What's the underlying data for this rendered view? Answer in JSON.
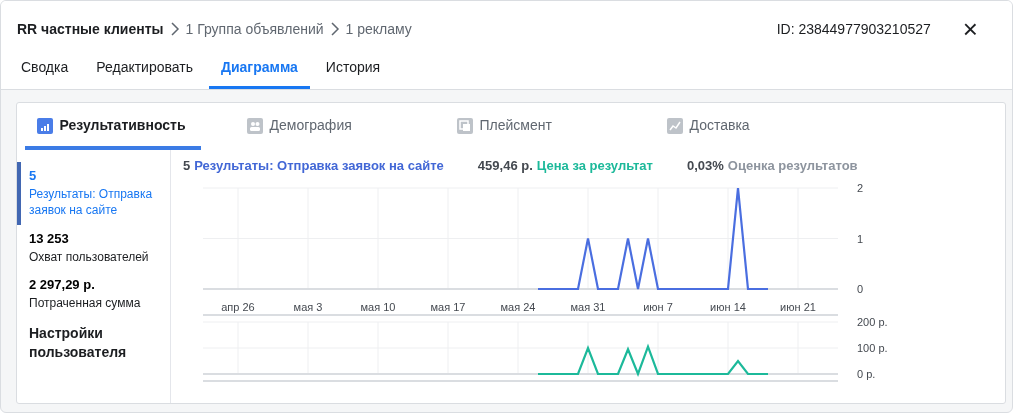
{
  "header": {
    "breadcrumb": [
      "RR частные клиенты",
      "1 Группа объявлений",
      "1 рекламу"
    ],
    "id": "ID: 23844977903210527",
    "close": "×"
  },
  "tabs": [
    {
      "label": "Сводка",
      "selected": false
    },
    {
      "label": "Редактировать",
      "selected": false
    },
    {
      "label": "Диаграмма",
      "selected": true
    },
    {
      "label": "История",
      "selected": false
    }
  ],
  "chart_tabs": [
    {
      "label": "Результативность",
      "selected": true,
      "kind": "bars"
    },
    {
      "label": "Демография",
      "selected": false,
      "kind": "people"
    },
    {
      "label": "Плейсмент",
      "selected": false,
      "kind": "squares"
    },
    {
      "label": "Доставка",
      "selected": false,
      "kind": "trend"
    }
  ],
  "metrics": [
    {
      "value": "5",
      "label": "Результаты: Отправка заявок на сайте",
      "selected": true
    },
    {
      "value": "13 253",
      "label": "Охват пользователей",
      "selected": false
    },
    {
      "value": "2 297,29 р.",
      "label": "Потраченная сумма",
      "selected": false
    }
  ],
  "settings_label": "Настройки пользователя",
  "summary": [
    {
      "value": "5",
      "label": "Результаты: Отправка заявок на сайте",
      "color": "#4267d6"
    },
    {
      "value": "459,46 р.",
      "label": "Цена за результат",
      "color": "#1cb99a"
    },
    {
      "value": "0,03%",
      "label": "Оценка результатов",
      "color": "#8d949e"
    }
  ],
  "charts": [
    {
      "chart_data": {
        "type": "line",
        "categories": [
          "апр 26",
          null,
          null,
          null,
          null,
          null,
          null,
          "мая 3",
          null,
          null,
          null,
          null,
          null,
          null,
          "мая 10",
          null,
          null,
          null,
          null,
          null,
          null,
          "мая 17",
          null,
          null,
          null,
          null,
          null,
          null,
          "мая 24",
          null,
          null,
          null,
          null,
          null,
          null,
          "мая 31",
          null,
          null,
          null,
          null,
          null,
          null,
          "июн 7",
          null,
          null,
          null,
          null,
          null,
          null,
          "июн 14",
          null,
          null,
          null,
          null,
          null,
          null,
          "июн 21"
        ],
        "series": [
          {
            "color": "#4a6ee0",
            "values": [
              null,
              null,
              null,
              null,
              null,
              null,
              null,
              null,
              null,
              null,
              null,
              null,
              null,
              null,
              null,
              null,
              null,
              null,
              null,
              null,
              null,
              null,
              null,
              null,
              null,
              null,
              null,
              null,
              null,
              null,
              0,
              0,
              0,
              0,
              0,
              1,
              0,
              0,
              0,
              1,
              0,
              1,
              0,
              0,
              0,
              0,
              0,
              0,
              0,
              0,
              2,
              0,
              0,
              0,
              null,
              null,
              null
            ]
          }
        ],
        "ylim": [
          0,
          2
        ],
        "yticks": [
          0,
          1,
          2
        ],
        "grid": true
      }
    },
    {
      "chart_data": {
        "type": "line",
        "categories": [
          null,
          null,
          null,
          null,
          null,
          null,
          null,
          null,
          null,
          null,
          null,
          null,
          null,
          null,
          null,
          null,
          null,
          null,
          null,
          null,
          null,
          null,
          null,
          null,
          null,
          null,
          null,
          null,
          null,
          null,
          null,
          null,
          null,
          null,
          null,
          null,
          null,
          null,
          null,
          null,
          null,
          null,
          null,
          null,
          null,
          null,
          null,
          null,
          null,
          null,
          null,
          null,
          null,
          null,
          null,
          null,
          null
        ],
        "series": [
          {
            "color": "#1cb99a",
            "values": [
              null,
              null,
              null,
              null,
              null,
              null,
              null,
              null,
              null,
              null,
              null,
              null,
              null,
              null,
              null,
              null,
              null,
              null,
              null,
              null,
              null,
              null,
              null,
              null,
              null,
              null,
              null,
              null,
              null,
              null,
              0,
              0,
              0,
              0,
              0,
              100,
              0,
              0,
              0,
              95,
              0,
              105,
              0,
              0,
              0,
              0,
              0,
              0,
              0,
              0,
              50,
              0,
              0,
              0,
              null,
              null,
              null
            ]
          }
        ],
        "ylim": [
          0,
          200
        ],
        "grid": true,
        "yticks": [
          {
            "value": 0,
            "label": "0 р."
          },
          {
            "value": 100,
            "label": "100 р."
          },
          {
            "value": 200,
            "label": "200 р."
          }
        ]
      }
    }
  ]
}
